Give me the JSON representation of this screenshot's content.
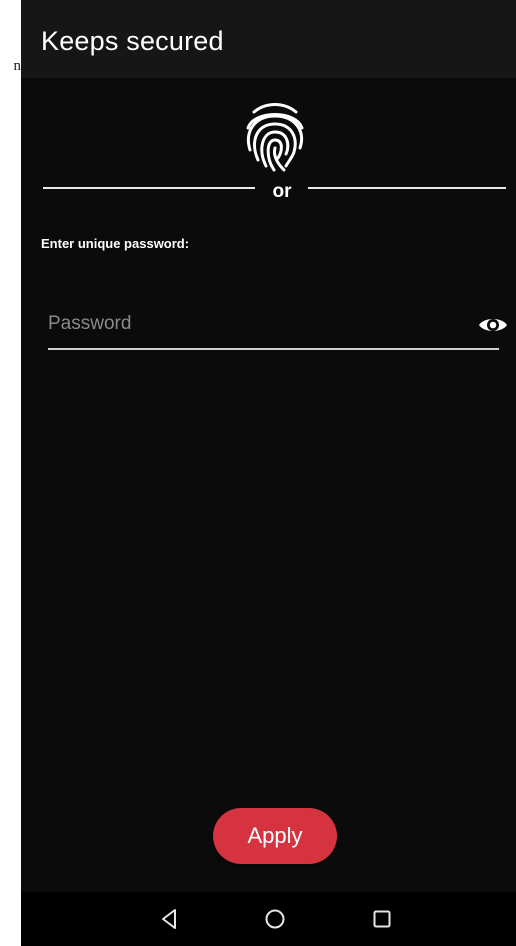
{
  "margin": {
    "glyph": "n"
  },
  "appbar": {
    "title": "Keeps secured"
  },
  "auth": {
    "fingerprint_icon": "fingerprint-icon",
    "divider_text": "or",
    "prompt": "Enter unique password:",
    "password": {
      "placeholder": "Password",
      "value": "",
      "toggle_icon": "eye-icon"
    },
    "apply_label": "Apply"
  },
  "navbar": {
    "back_icon": "back-triangle-icon",
    "home_icon": "home-circle-icon",
    "recents_icon": "recents-square-icon"
  },
  "colors": {
    "background": "#0b0b0b",
    "appbar": "#161616",
    "accent": "#d63340",
    "text": "#ffffff",
    "placeholder": "#8a8a8a"
  }
}
